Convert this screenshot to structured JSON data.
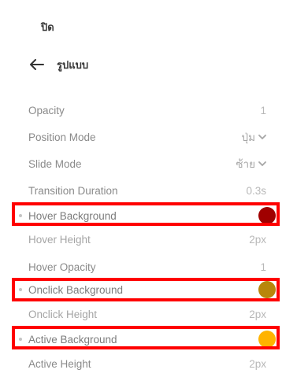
{
  "panel": {
    "close_label": "ปิด",
    "section_title": "รูปแบบ",
    "back_icon": "arrow-left-icon"
  },
  "settings": {
    "opacity": {
      "label": "Opacity",
      "value": "1"
    },
    "position_mode": {
      "label": "Position Mode",
      "value": "ปุ่ม"
    },
    "slide_mode": {
      "label": "Slide Mode",
      "value": "ซ้าย"
    },
    "transition_duration": {
      "label": "Transition Duration",
      "value": "0.3s"
    },
    "hover_background": {
      "label": "Hover Background",
      "color": "#a00000"
    },
    "hover_height": {
      "label": "Hover Height",
      "value": "2px"
    },
    "hover_opacity": {
      "label": "Hover Opacity",
      "value": "1"
    },
    "onclick_background": {
      "label": "Onclick Background",
      "color": "#b8860b"
    },
    "onclick_height": {
      "label": "Onclick Height",
      "value": "2px"
    },
    "active_background": {
      "label": "Active Background",
      "color": "#ffb300"
    },
    "active_height": {
      "label": "Active Height",
      "value": "2px"
    }
  },
  "highlight_color": "#ff0000"
}
